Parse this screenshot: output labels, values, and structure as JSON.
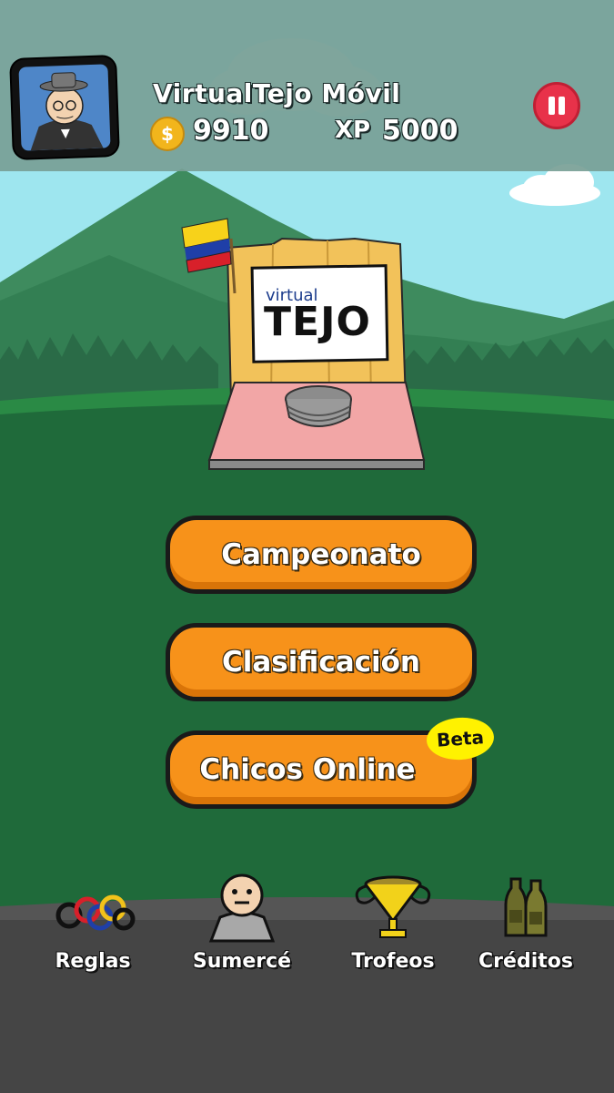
{
  "header": {
    "player_name": "VirtualTejo Móvil",
    "coins_symbol": "$",
    "coins": "9910",
    "xp_label": "XP",
    "xp": "5000",
    "pause_icon": "pause-icon"
  },
  "logo": {
    "small_text": "virtual",
    "big_text": "TEJO"
  },
  "menu": {
    "buttons": [
      {
        "label": "Campeonato"
      },
      {
        "label": "Clasificación"
      },
      {
        "label": "Chicos Online"
      }
    ],
    "beta_badge": "Beta"
  },
  "bottom_nav": [
    {
      "label": "Reglas",
      "icon": "rings-icon"
    },
    {
      "label": "Sumercé",
      "icon": "character-icon"
    },
    {
      "label": "Trofeos",
      "icon": "trophy-icon"
    },
    {
      "label": "Créditos",
      "icon": "bottles-icon"
    }
  ],
  "colors": {
    "accent_orange": "#f7921a",
    "pause_red": "#e8324a",
    "beta_yellow": "#fff200",
    "sky": "#9ee6ef",
    "grass": "#1f6a3a",
    "bottom_bar": "#444444"
  }
}
